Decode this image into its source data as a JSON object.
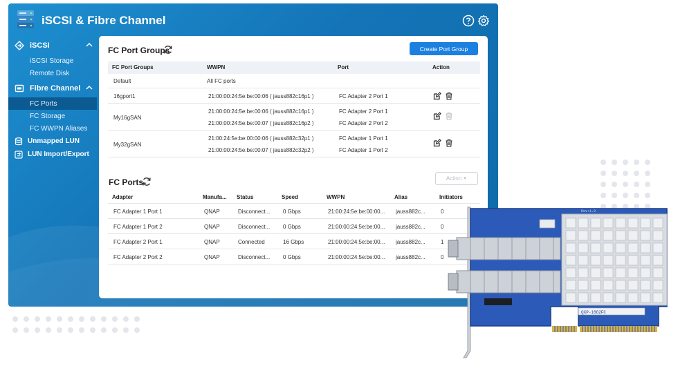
{
  "window": {
    "title": "iSCSI & Fibre Channel"
  },
  "icons": {
    "app": "server-stack-icon",
    "help": "help-icon",
    "settings": "gear-icon",
    "refresh": "refresh-icon",
    "edit": "edit-icon",
    "delete": "trash-icon"
  },
  "sidebar": {
    "iscsi": {
      "label": "iSCSI",
      "items": [
        "iSCSI Storage",
        "Remote Disk"
      ]
    },
    "fibre": {
      "label": "Fibre Channel",
      "items": [
        "FC Ports",
        "FC Storage",
        "FC WWPN Aliases"
      ]
    },
    "unmapped": "Unmapped LUN",
    "lun_import": "LUN Import/Export",
    "active_item": "FC Ports"
  },
  "port_groups": {
    "title": "FC Port Groups",
    "create_label": "Create Port Group",
    "headers": [
      "FC Port Groups",
      "WWPN",
      "Port",
      "Action"
    ],
    "rows": [
      {
        "name": "Default",
        "wwpn": [
          "All FC ports"
        ],
        "port": [],
        "actions": false
      },
      {
        "name": "16gport1",
        "wwpn": [
          "21:00:00:24:5e:be:00:06 ( jauss882c16p1 )"
        ],
        "port": [
          "FC Adapter 2 Port 1"
        ],
        "actions": true,
        "delete_enabled": true
      },
      {
        "name": "My16gSAN",
        "wwpn": [
          "21:00:00:24:5e:be:00:06 ( jauss882c16p1 )",
          "21:00:00:24:5e:be:00:07 ( jauss882c16p2 )"
        ],
        "port": [
          "FC Adapter 2 Port 1",
          "FC Adapter 2 Port 2"
        ],
        "actions": true,
        "delete_enabled": false
      },
      {
        "name": "My32gSAN",
        "wwpn": [
          "21:00:24:5e:be:00:00:06 ( jauss882c32p1 )",
          "21:00:00:24:5e:be:00:07 ( jauss882c32p2 )"
        ],
        "port": [
          "FC Adapter 1 Port 1",
          "FC Adapter 1 Port 2"
        ],
        "actions": true,
        "delete_enabled": true
      }
    ]
  },
  "fc_ports": {
    "title": "FC Ports",
    "action_label": "Action",
    "headers": [
      "Adapter",
      "Manufa...",
      "Status",
      "Speed",
      "WWPN",
      "Alias",
      "Initiators"
    ],
    "rows": [
      [
        "FC Adapter 1 Port 1",
        "QNAP",
        "Disconnect...",
        "0 Gbps",
        "21:00:24:5e:be:00:00...",
        "jauss882c...",
        "0"
      ],
      [
        "FC Adapter 1 Port 2",
        "QNAP",
        "Disconnect...",
        "0 Gbps",
        "21:00:00:24:5e:be:00...",
        "jauss882c...",
        "0"
      ],
      [
        "FC Adapter 2 Port 1",
        "QNAP",
        "Connected",
        "16 Gbps",
        "21:00:00:24:5e:be:00...",
        "jauss882c...",
        "1"
      ],
      [
        "FC Adapter 2 Port 2",
        "QNAP",
        "Disconnect...",
        "0 Gbps",
        "21:00:00:24:5e:be:00...",
        "jauss882c...",
        "0"
      ]
    ]
  },
  "card": {
    "label": "Rev:1.0",
    "sticker": "QXP-16G2FC"
  },
  "colors": {
    "accent": "#1b80e0",
    "window": "#1474b7",
    "active_nav": "#0c5a92"
  }
}
